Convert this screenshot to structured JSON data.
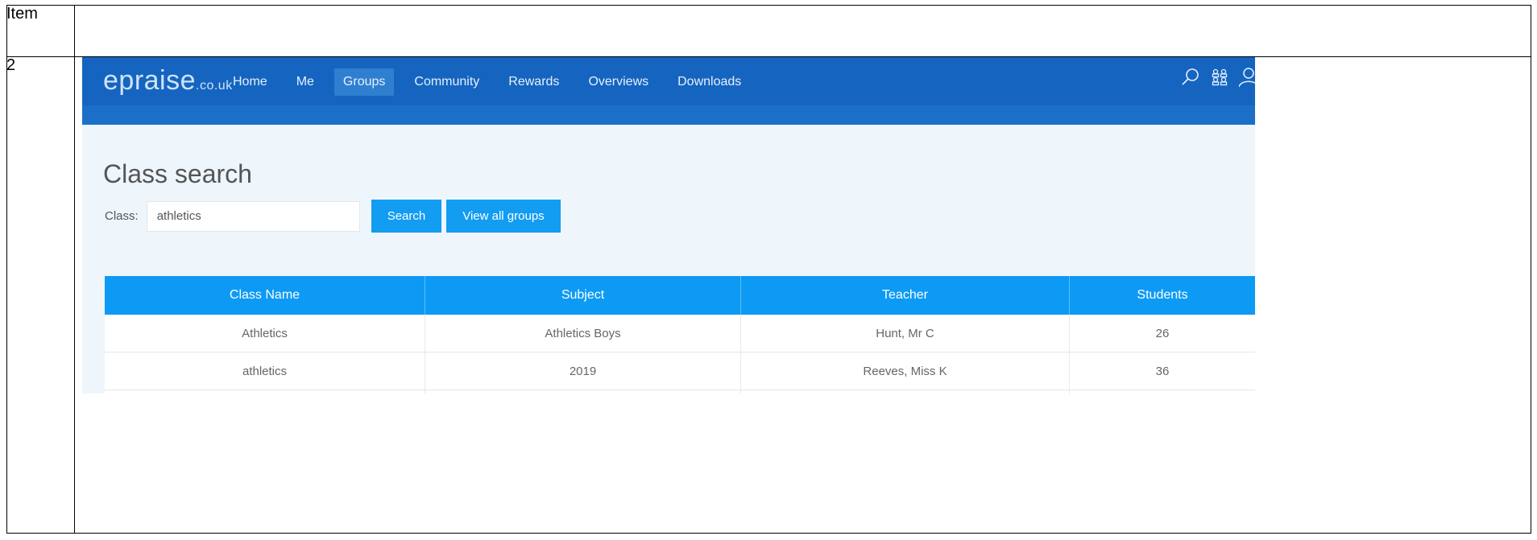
{
  "doc": {
    "header_label": "Item",
    "row_number": "2"
  },
  "app": {
    "logo_main": "epraise",
    "logo_domain": ".co.uk",
    "nav": [
      {
        "label": "Home"
      },
      {
        "label": "Me"
      },
      {
        "label": "Groups"
      },
      {
        "label": "Community"
      },
      {
        "label": "Rewards"
      },
      {
        "label": "Overviews"
      },
      {
        "label": "Downloads"
      }
    ],
    "active_nav": "Groups",
    "icons": [
      "search-icon",
      "groups-icon",
      "user-icon"
    ]
  },
  "main": {
    "title": "Class search",
    "search": {
      "label": "Class:",
      "value": "athletics"
    },
    "buttons": {
      "search": "Search",
      "view_all": "View all groups"
    },
    "table": {
      "headers": [
        "Class Name",
        "Subject",
        "Teacher",
        "Students"
      ],
      "rows": [
        [
          "Athletics",
          "Athletics Boys",
          "Hunt, Mr C",
          "26"
        ],
        [
          "athletics",
          "2019",
          "Reeves, Miss K",
          "36"
        ]
      ]
    }
  },
  "colors": {
    "topbar": "#1565c0",
    "accent": "#0d9af5",
    "page_bg": "#eef6fc"
  }
}
